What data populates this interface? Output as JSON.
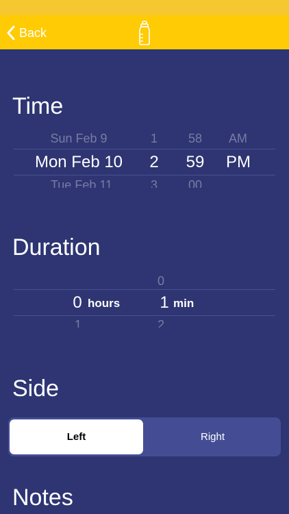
{
  "nav": {
    "back_label": "Back"
  },
  "time": {
    "title": "Time",
    "picker": {
      "above": {
        "date": "Sun Feb 9",
        "hour": "1",
        "minute": "58",
        "period": "AM"
      },
      "selected": {
        "date": "Mon Feb 10",
        "hour": "2",
        "minute": "59",
        "period": "PM"
      },
      "below": {
        "date": "Tue Feb 11",
        "hour": "3",
        "minute": "00",
        "period": ""
      }
    }
  },
  "duration": {
    "title": "Duration",
    "picker": {
      "above": {
        "hours": "",
        "minutes": "0"
      },
      "selected": {
        "hours": "0",
        "hours_unit": "hours",
        "minutes": "1",
        "minutes_unit": "min"
      },
      "below": {
        "hours": "1",
        "minutes": "2"
      }
    }
  },
  "side": {
    "title": "Side",
    "options": [
      "Left",
      "Right"
    ],
    "selected": "Left"
  },
  "notes": {
    "title": "Notes"
  },
  "colors": {
    "background": "#2e3572",
    "nav_bar": "#fecb05",
    "segment_track": "#444d94",
    "segment_selected": "#ffffff"
  }
}
